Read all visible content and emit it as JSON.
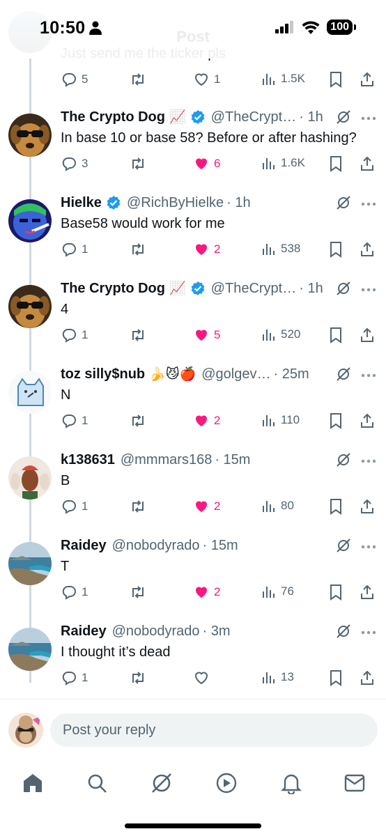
{
  "status_bar": {
    "time": "10:50",
    "battery": "100"
  },
  "header": {
    "title": "Post"
  },
  "partial_tweet": {
    "body": "Just send me the ticker pls",
    "replies": "5",
    "reposts": "",
    "likes": "1",
    "views": "1.5K",
    "liked": false
  },
  "tweets": [
    {
      "name": "The Crypto Dog",
      "emoji": "📈",
      "verified": true,
      "handle": "@TheCrypt…",
      "time": "· 1h",
      "body": "In base 10 or base 58? Before or after hashing?",
      "replies": "3",
      "likes": "6",
      "views": "1.6K",
      "liked": true,
      "avatar": "dog"
    },
    {
      "name": "Hielke",
      "emoji": "",
      "verified": true,
      "handle": "@RichByHielke",
      "time": "· 1h",
      "body": "Base58 would work for me",
      "replies": "1",
      "likes": "2",
      "views": "538",
      "liked": true,
      "avatar": "blue-face"
    },
    {
      "name": "The Crypto Dog",
      "emoji": "📈",
      "verified": true,
      "handle": "@TheCrypt…",
      "time": "· 1h",
      "body": "4",
      "replies": "1",
      "likes": "5",
      "views": "520",
      "liked": true,
      "avatar": "dog"
    },
    {
      "name": "toz silly$nub",
      "emoji": "🍌😼🍎",
      "verified": false,
      "handle": "@golgev…",
      "time": "· 25m",
      "body": "N",
      "replies": "1",
      "likes": "2",
      "views": "110",
      "liked": true,
      "avatar": "cat"
    },
    {
      "name": "k138631",
      "emoji": "",
      "verified": false,
      "handle": "@mmmars168",
      "time": "· 15m",
      "body": "B",
      "replies": "1",
      "likes": "2",
      "views": "80",
      "liked": true,
      "avatar": "masks"
    },
    {
      "name": "Raidey",
      "emoji": "",
      "verified": false,
      "handle": "@nobodyrado",
      "time": "· 15m",
      "body": "T",
      "replies": "1",
      "likes": "2",
      "views": "76",
      "liked": true,
      "avatar": "coast"
    },
    {
      "name": "Raidey",
      "emoji": "",
      "verified": false,
      "handle": "@nobodyrado",
      "time": "· 3m",
      "body": "I thought it’s dead",
      "replies": "1",
      "likes": "",
      "views": "13",
      "liked": false,
      "avatar": "coast"
    }
  ],
  "composer": {
    "placeholder": "Post your reply"
  },
  "nav": [
    "home-icon",
    "search-icon",
    "grok-icon",
    "video-icon",
    "notifications-icon",
    "messages-icon"
  ],
  "colors": {
    "like": "#f91880",
    "verified": "#1d9bf0",
    "muted": "#536471",
    "text": "#0f1419"
  }
}
